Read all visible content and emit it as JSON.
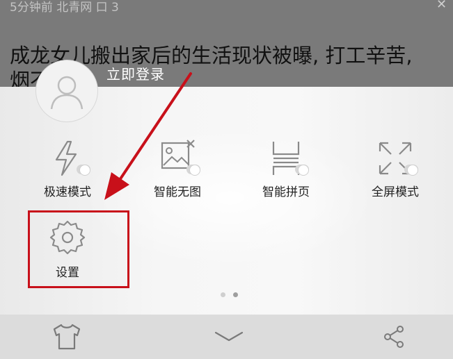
{
  "article": {
    "meta": "5分钟前  北青网 口 3",
    "headline_line1": "成龙女儿搬出家后的生活现状被曝, 打工辛苦,",
    "headline_line2": "烟不"
  },
  "login": {
    "label": "立即登录"
  },
  "menu": {
    "items": [
      {
        "label": "极速模式",
        "icon": "lightning-icon"
      },
      {
        "label": "智能无图",
        "icon": "no-image-icon"
      },
      {
        "label": "智能拼页",
        "icon": "page-merge-icon"
      },
      {
        "label": "全屏模式",
        "icon": "fullscreen-icon"
      },
      {
        "label": "设置",
        "icon": "gear-icon"
      }
    ],
    "page_count": 2,
    "active_page": 1
  },
  "bottom_bar": {
    "buttons": [
      "theme-shirt-icon",
      "collapse-chevron-icon",
      "share-icon"
    ]
  },
  "colors": {
    "annotation_red": "#c8101a",
    "icon_gray": "#8a8a8a",
    "toggle_off": "#d6d6d6"
  }
}
